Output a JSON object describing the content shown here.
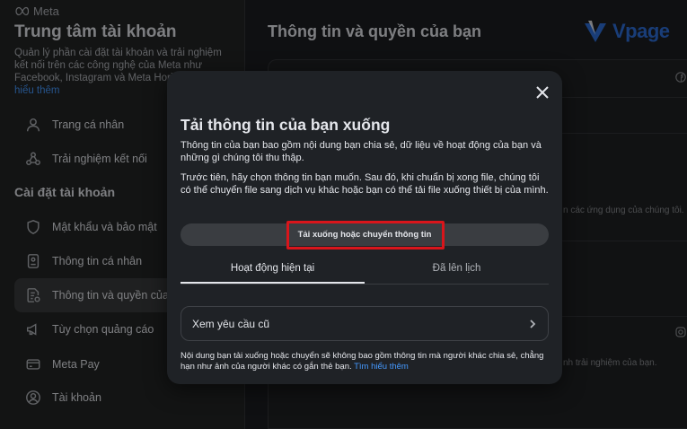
{
  "sidebar": {
    "logo_text": "Meta",
    "title": "Trung tâm tài khoản",
    "description": "Quản lý phần cài đặt tài khoản và trải nghiệm kết nối trên các công nghệ của Meta như Facebook, Instagram và Meta Horizon.",
    "learn_more": "hiểu thêm",
    "items_top": [
      {
        "label": "Trang cá nhân",
        "icon": "person-icon"
      },
      {
        "label": "Trải nghiệm kết nối",
        "icon": "connected-icon"
      }
    ],
    "section_label": "Cài đặt tài khoản",
    "items": [
      {
        "label": "Mật khẩu và bảo mật",
        "icon": "shield-icon"
      },
      {
        "label": "Thông tin cá nhân",
        "icon": "id-card-icon"
      },
      {
        "label": "Thông tin và quyền của bạn",
        "icon": "info-permissions-icon",
        "active": true
      },
      {
        "label": "Tùy chọn quảng cáo",
        "icon": "megaphone-icon"
      },
      {
        "label": "Meta Pay",
        "icon": "card-icon"
      },
      {
        "label": "Tài khoản",
        "icon": "account-icon"
      }
    ]
  },
  "content": {
    "title": "Thông tin và quyền của bạn",
    "brand": "Vpage",
    "bg_text_1": "n các ứng dụng của chúng tôi.",
    "bg_text_2": "nh trải nghiệm của bạn."
  },
  "modal": {
    "title": "Tải thông tin của bạn xuống",
    "paragraph1": "Thông tin của bạn bao gồm nội dung bạn chia sẻ, dữ liệu về hoạt động của bạn và những gì chúng tôi thu thập.",
    "paragraph2": "Trước tiên, hãy chọn thông tin bạn muốn. Sau đó, khi chuẩn bị xong file, chúng tôi có thể chuyển file sang dịch vụ khác hoặc bạn có thể tải file xuống thiết bị của mình.",
    "download_button": "Tải xuống hoặc chuyển thông tin",
    "tabs": [
      {
        "label": "Hoạt động hiện tại",
        "active": true
      },
      {
        "label": "Đã lên lịch",
        "active": false
      }
    ],
    "old_requests": "Xem yêu cầu cũ",
    "footer_text": "Nội dung bạn tải xuống hoặc chuyển sẽ không bao gồm thông tin mà người khác chia sẻ, chẳng hạn như ảnh của người khác có gắn thẻ bạn.",
    "footer_link": "Tìm hiểu thêm"
  },
  "colors": {
    "highlight": "#d9151b",
    "link": "#4599ff",
    "brand": "#2f6fdb"
  }
}
